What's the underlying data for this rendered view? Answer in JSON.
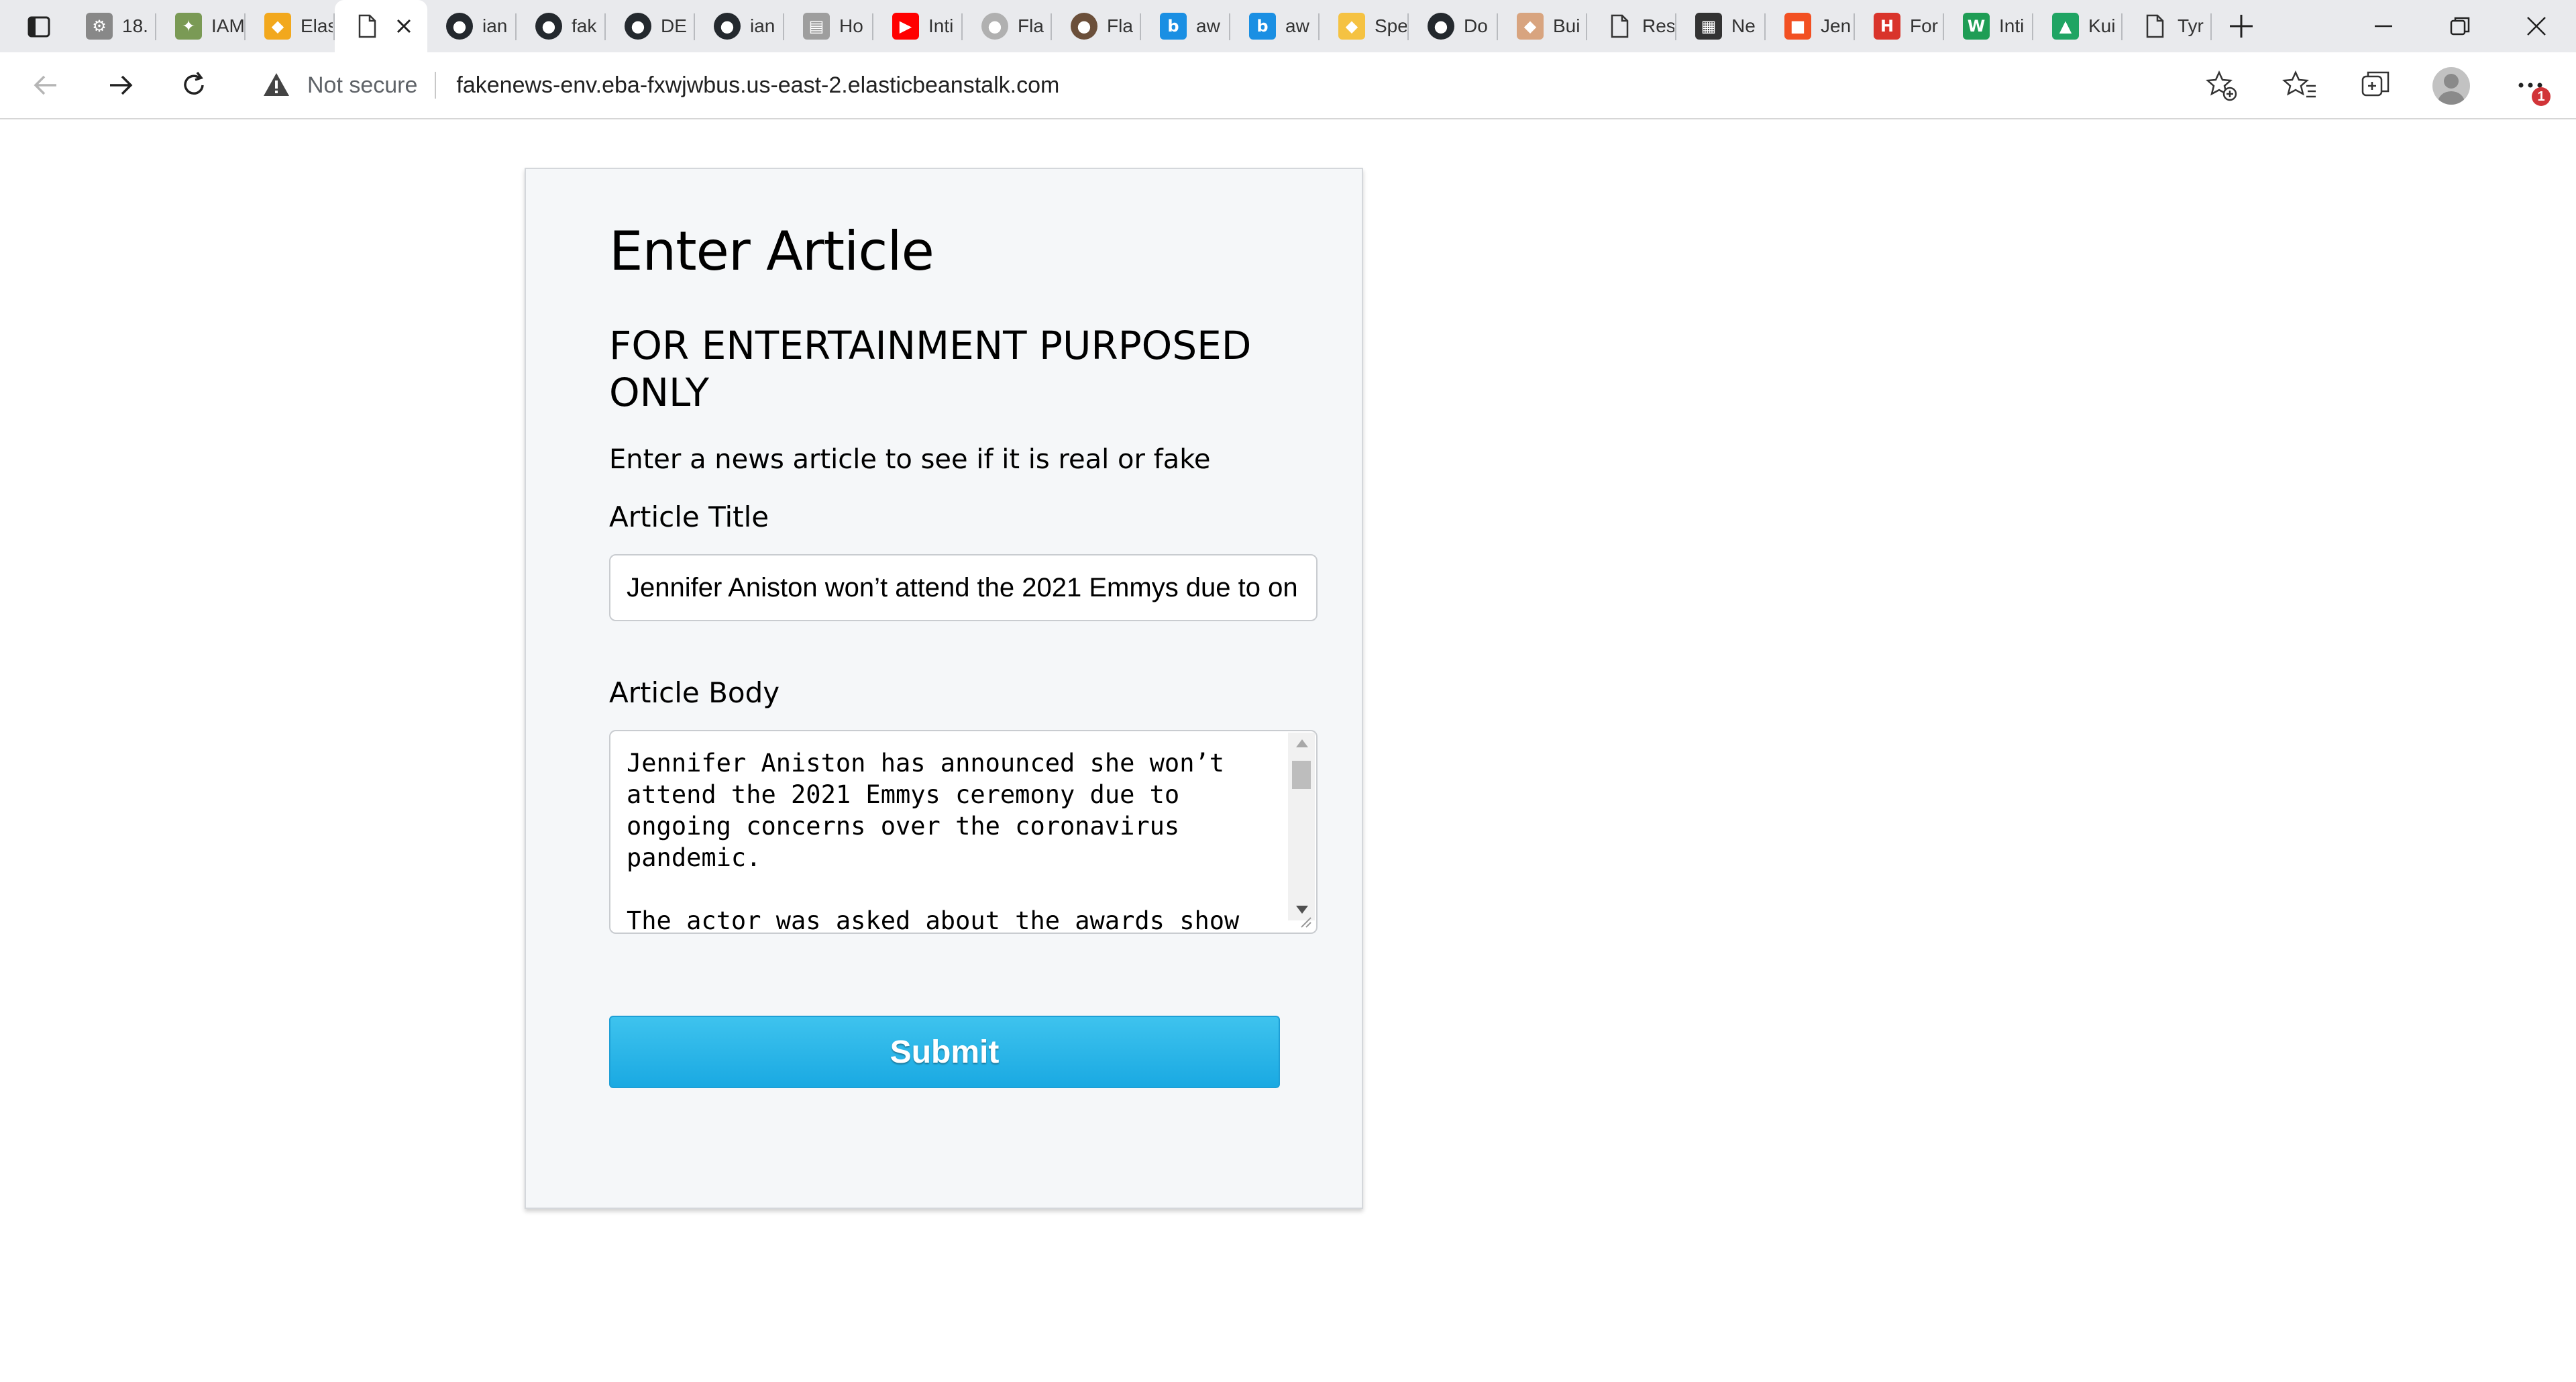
{
  "browser": {
    "tabs": [
      {
        "label": "18.",
        "icon": "document-settings-icon",
        "color": "#888888"
      },
      {
        "label": "IAM",
        "icon": "key-icon",
        "color": "#7a9a55"
      },
      {
        "label": "Elas",
        "icon": "aws-cube-icon",
        "color": "#f2a81d"
      },
      {
        "label": "",
        "icon": "page-icon",
        "color": "#333333",
        "active": true
      },
      {
        "label": "ian",
        "icon": "github-icon",
        "color": "#24292e"
      },
      {
        "label": "fak",
        "icon": "github-icon",
        "color": "#24292e"
      },
      {
        "label": "DE",
        "icon": "github-icon",
        "color": "#24292e"
      },
      {
        "label": "ian",
        "icon": "github-icon",
        "color": "#24292e"
      },
      {
        "label": "Ho",
        "icon": "grey-tile-icon",
        "color": "#9e9e9e"
      },
      {
        "label": "Inti",
        "icon": "youtube-icon",
        "color": "#ff0000"
      },
      {
        "label": "Fla",
        "icon": "avatar-icon",
        "color": "#b0b0b0"
      },
      {
        "label": "Fla",
        "icon": "avatar-icon",
        "color": "#6b4f3a"
      },
      {
        "label": "aw",
        "icon": "bing-icon",
        "color": "#1a8fe3"
      },
      {
        "label": "aw",
        "icon": "bing-icon",
        "color": "#1a8fe3"
      },
      {
        "label": "Spe",
        "icon": "package-icon",
        "color": "#f5c242"
      },
      {
        "label": "Do",
        "icon": "github-icon",
        "color": "#24292e"
      },
      {
        "label": "Bui",
        "icon": "box-icon",
        "color": "#d8a47f"
      },
      {
        "label": "Res",
        "icon": "page-icon",
        "color": "#333333"
      },
      {
        "label": "Ne",
        "icon": "calendar-icon",
        "color": "#333333"
      },
      {
        "label": "Jen",
        "icon": "microsoft-icon",
        "color": "#f25022"
      },
      {
        "label": "For",
        "icon": "hsu-icon",
        "color": "#d9342b"
      },
      {
        "label": "Inti",
        "icon": "w-icon",
        "color": "#1f9d55"
      },
      {
        "label": "Kui",
        "icon": "google-drive-icon",
        "color": "#1fa463"
      },
      {
        "label": "Tyr",
        "icon": "page-icon",
        "color": "#333333"
      }
    ],
    "security_label": "Not secure",
    "url": "fakenews-env.eba-fxwjwbus.us-east-2.elasticbeanstalk.com",
    "notification_count": "1"
  },
  "page": {
    "heading": "Enter Article",
    "subheading": "FOR ENTERTAINMENT PURPOSED ONLY",
    "instruction": "Enter a news article to see if it is real or fake",
    "title_label": "Article Title",
    "title_value": "Jennifer Aniston won’t attend the 2021 Emmys due to on",
    "body_label": "Article Body",
    "body_value": "Jennifer Aniston has announced she won’t\nattend the 2021 Emmys ceremony due to\nongoing concerns over the coronavirus\npandemic.\n\nThe actor was asked about the awards show",
    "submit_label": "Submit",
    "accent_color": "#1aa9e2"
  }
}
